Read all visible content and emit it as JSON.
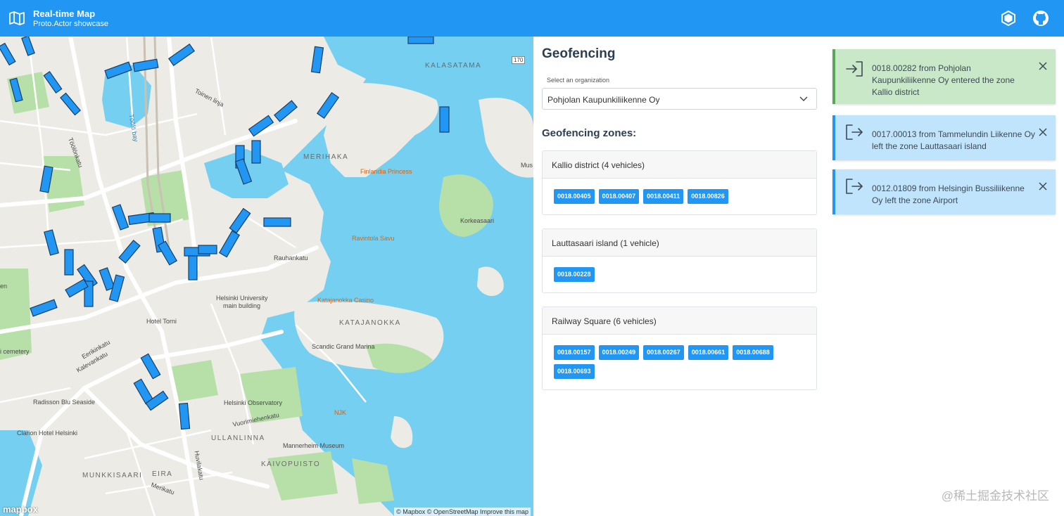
{
  "header": {
    "title": "Real-time Map",
    "subtitle": "Proto.Actor showcase",
    "icons": [
      "map-icon",
      "protoactor-icon",
      "github-icon"
    ],
    "color": "#2196f3"
  },
  "map": {
    "labels": {
      "kalasatama": "KALASATAMA",
      "road_170": "170",
      "toinen_linja": "Toinen linja",
      "toolo_bay": "Töölö bay",
      "toolonkatu": "Töölönkatu",
      "merihaka": "MERIHAKA",
      "finlandia_princess": "Finlandia Princess",
      "korkeasaari": "Korkeasaari",
      "ravintola_savu": "Ravintola Savu",
      "rauhankatu": "Rauhankatu",
      "helsinki_university": "Helsinki University",
      "main_building": "main building",
      "katajanokka_casino": "Katajanokka Casino",
      "katajanokka": "KATAJANOKKA",
      "hotel_torni": "Hotel Torni",
      "scandic": "Scandic Grand Marina",
      "eerikinkatu": "Eerikinkatu",
      "kalevankatu": "Kalevankatu",
      "cemetery": "i cemetery",
      "radisson": "Radisson Blu Seaside",
      "helsinki_observatory": "Helsinki Observatory",
      "njk": "NJK",
      "clarion": "Clarion Hotel Helsinki",
      "vuorimiehenkatu": "Vuorimiehenkatu",
      "ullanlinna": "ULLANLINNA",
      "mannerheim_museum": "Mannerheim Museum",
      "huvilakatu": "Huvilakatu",
      "kaivopuisto": "KAIVOPUISTO",
      "munkkisaari": "MUNKKISAARI",
      "eira": "EIRA",
      "merikatu": "Merikatu",
      "mus": "Mus",
      "en": "en"
    },
    "logo": "mapbox",
    "attribution": "© Mapbox © OpenStreetMap Improve this map"
  },
  "panel": {
    "title": "Geofencing",
    "select_label": "Select an organization",
    "select_value": "Pohjolan Kaupunkiliikenne Oy",
    "zones_title": "Geofencing zones:",
    "zones": [
      {
        "name": "Kallio district (4 vehicles)",
        "vehicles": [
          "0018.00405",
          "0018.00407",
          "0018.00411",
          "0018.00826"
        ]
      },
      {
        "name": "Lauttasaari island (1 vehicle)",
        "vehicles": [
          "0018.00228"
        ]
      },
      {
        "name": "Railway Square (6 vehicles)",
        "vehicles": [
          "0018.00157",
          "0018.00249",
          "0018.00267",
          "0018.00661",
          "0018.00688",
          "0018.00693"
        ]
      }
    ]
  },
  "notifications": [
    {
      "type": "enter",
      "icon": "sign-in-icon",
      "text": "0018.00282 from Pohjolan Kaupunkiliikenne Oy entered the zone Kallio district"
    },
    {
      "type": "leave",
      "icon": "sign-out-icon",
      "text": "0017.00013 from Tammelundin Liikenne Oy left the zone Lauttasaari island"
    },
    {
      "type": "leave",
      "icon": "sign-out-icon",
      "text": "0012.01809 from Helsingin Bussiliikenne Oy left the zone Airport"
    }
  ],
  "watermark": "@稀土掘金技术社区"
}
